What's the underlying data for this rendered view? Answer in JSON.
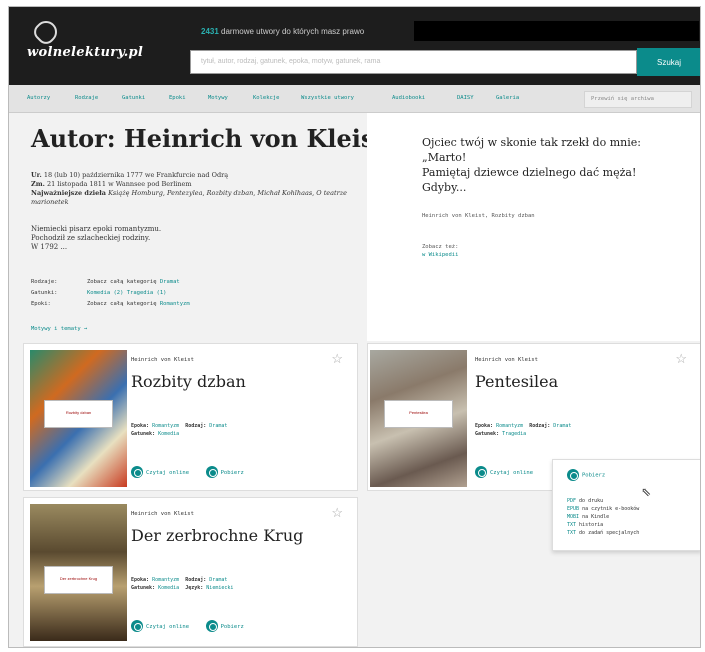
{
  "logo": {
    "text": "wolnelektury.pl"
  },
  "promo": {
    "count": "2431",
    "text": "darmowe utwory do których masz prawo",
    "link": "masz prawo"
  },
  "search": {
    "placeholder": "tytuł, autor, rodzaj, gatunek, epoka, motyw, gatunek, rama",
    "button": "Szukaj"
  },
  "nav": {
    "items": [
      "Autorzy",
      "Rodzaje",
      "Gatunki",
      "Epoki",
      "Motywy",
      "Kolekcje",
      "Wszystkie utwory",
      "Audiobooki",
      "DAISY",
      "Galeria"
    ],
    "select": "Przewiń się archiwa"
  },
  "author": {
    "title": "Autor: Heinrich von Kleist",
    "birth_label": "Ur.",
    "birth": "18 (lub 10) października 1777 we Frankfurcie nad Odrą",
    "death_label": "Zm.",
    "death": "21 listopada 1811 w Wannsee pod Berlinem",
    "works_label": "Najważniejsze dzieła",
    "works": "Książę Homburg, Pentezylea, Rozbity dzban, Michał Kohlhaas, O teatrze marionetek",
    "bio": [
      "Niemiecki pisarz epoki romantyzmu.",
      "Pochodził ze szlacheckiej rodziny.",
      "W 1792 ..."
    ],
    "cats": [
      {
        "key": "Rodzaje:",
        "text": "Zobacz całą kategorię",
        "link": "Dramat"
      },
      {
        "key": "Gatunki:",
        "text": "Komedia (2)",
        "link": "Tragedia (1)"
      },
      {
        "key": "Epoki:",
        "text": "Zobacz całą kategorię",
        "link": "Romantyzm"
      }
    ],
    "more": "Motywy i tematy →"
  },
  "quote": {
    "lines": [
      "Ojciec twój w skonie tak rzekł do mnie:",
      "„Marto!",
      "Pamiętaj dziewce dzielnego dać męża!",
      "Gdyby..."
    ],
    "author": "Heinrich von Kleist, Rozbity dzban",
    "more_label": "Zobacz też:",
    "more_link": "w Wikipedii"
  },
  "books": [
    {
      "author": "Heinrich von Kleist",
      "title": "Rozbity dzban",
      "epoka": "Romantyzm",
      "rodzaj": "Dramat",
      "gatunek": "Komedia",
      "jezyk": "",
      "read": "Czytaj online",
      "download": "Pobierz",
      "cover_label": "Rozbity dzban"
    },
    {
      "author": "Heinrich von Kleist",
      "title": "Pentesilea",
      "epoka": "Romantyzm",
      "rodzaj": "Dramat",
      "gatunek": "Tragedia",
      "jezyk": "",
      "read": "Czytaj online",
      "download": "Pobierz",
      "cover_label": "Pentesilea"
    },
    {
      "author": "Heinrich von Kleist",
      "title": "Der zerbrochne Krug",
      "epoka": "Romantyzm",
      "rodzaj": "Dramat",
      "gatunek": "Komedia",
      "jezyk": "Niemiecki",
      "read": "Czytaj online",
      "download": "Pobierz",
      "cover_label": "Der zerbrochne Krug"
    }
  ],
  "labels": {
    "epoka": "Epoka:",
    "rodzaj": "Rodzaj:",
    "gatunek": "Gatunek:",
    "jezyk": "Język:"
  },
  "popup": {
    "button": "Pobierz",
    "items": [
      {
        "fmt": "PDF",
        "text": "do druku"
      },
      {
        "fmt": "EPUB",
        "text": "na czytnik e-booków"
      },
      {
        "fmt": "MOBI",
        "text": "na Kindle"
      },
      {
        "fmt": "TXT",
        "text": "historia"
      },
      {
        "fmt": "TXT",
        "text": "do zadań specjalnych"
      }
    ]
  },
  "colors": {
    "accent": "#0b8b8b",
    "topbar": "#1d1d1d"
  }
}
